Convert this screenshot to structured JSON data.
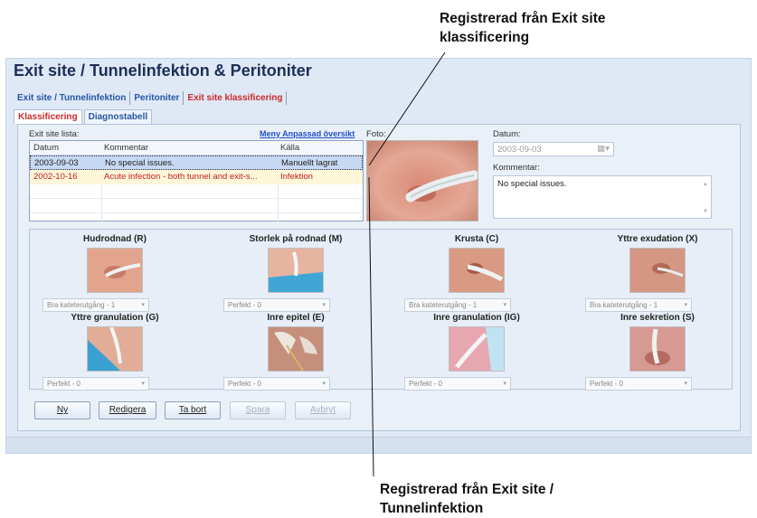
{
  "callouts": {
    "top_line1": "Registrerad från Exit site",
    "top_line2": "klassificering",
    "bottom_line1": "Registrerad från Exit site /",
    "bottom_line2": "Tunnelinfektion"
  },
  "app": {
    "title": "Exit site / Tunnelinfektion & Peritoniter",
    "tabs": [
      "Exit site / Tunnelinfektion",
      "Peritoniter",
      "Exit site klassificering"
    ],
    "subtabs": [
      "Klassificering",
      "Diagnostabell"
    ]
  },
  "list": {
    "label": "Exit site lista:",
    "link": "Meny Anpassad översikt",
    "headers": [
      "Datum",
      "Kommentar",
      "Källa"
    ],
    "rows": [
      [
        "2003-09-03",
        "No special issues.",
        "Manuellt lagrat"
      ],
      [
        "2002-10-16",
        "Acute infection - both tunnel and exit-s...",
        "Infektion"
      ]
    ]
  },
  "detail": {
    "photo_label": "Foto:",
    "date_label": "Datum:",
    "date_value": "2003-09-03",
    "comment_label": "Kommentar:",
    "comment_value": "No special issues."
  },
  "cards": [
    {
      "title": "Hudrodnad (R)",
      "value": "Bra kateterutgång - 1"
    },
    {
      "title": "Storlek på rodnad (M)",
      "value": "Perfekt - 0"
    },
    {
      "title": "Krusta (C)",
      "value": "Bra kateterutgång - 1"
    },
    {
      "title": "Yttre exudation (X)",
      "value": "Bra kateterutgång - 1"
    },
    {
      "title": "Yttre granulation (G)",
      "value": "Perfekt - 0"
    },
    {
      "title": "Inre epitel (E)",
      "value": "Perfekt - 0"
    },
    {
      "title": "Inre granulation (IG)",
      "value": "Perfekt - 0"
    },
    {
      "title": "Inre sekretion (S)",
      "value": "Perfekt - 0"
    }
  ],
  "buttons": {
    "new": "Ny",
    "edit": "Redigera",
    "delete": "Ta bort",
    "save": "Spara",
    "cancel": "Avbryt"
  },
  "colors": {
    "title": "#1c2f57",
    "active_tab": "#cc2a2a",
    "link": "#1f4fc9",
    "warning_row": "#c02020"
  }
}
